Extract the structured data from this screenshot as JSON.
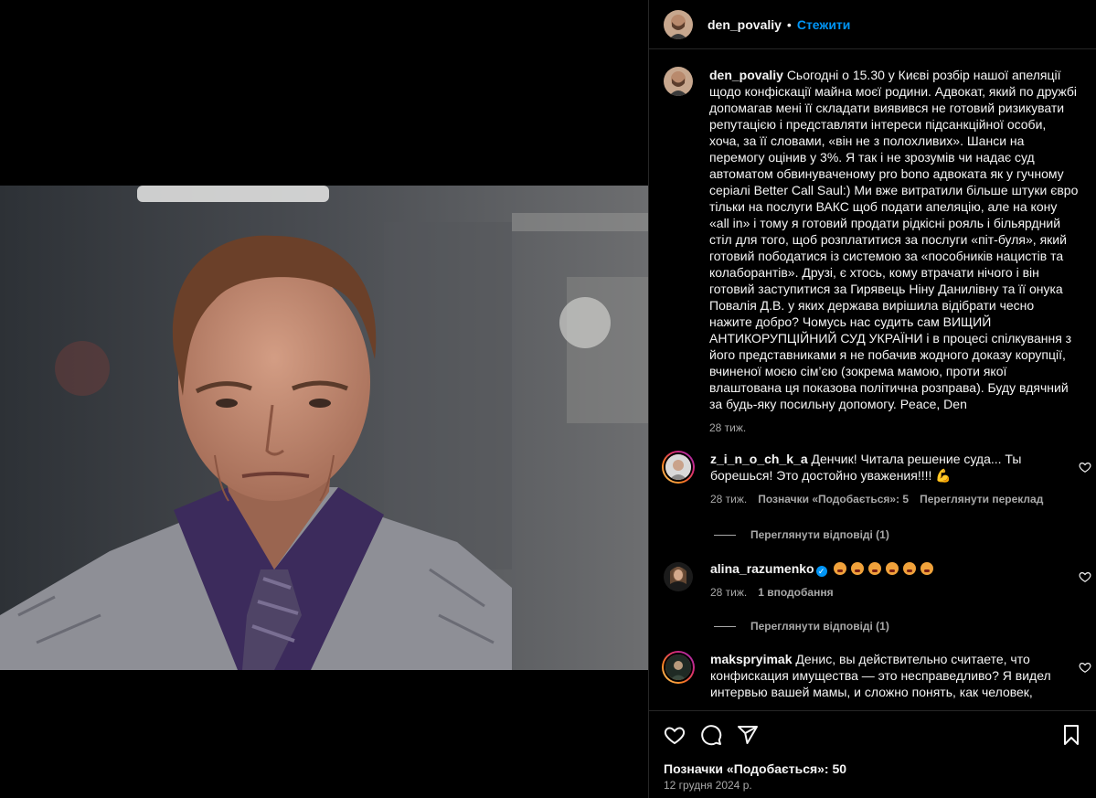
{
  "header": {
    "username": "den_povaliy",
    "separator": "•",
    "follow_label": "Стежити"
  },
  "caption": {
    "username": "den_povaliy",
    "text": "Сьогодні о 15.30 у Києві розбір нашої апеляції щодо конфіскації майна моєї родини. Адвокат, який по дружбі допомагав мені її складати виявився не готовий ризикувати репутацією і представляти інтереси підсанкційної особи, хоча, за її словами, «він не з полохливих». Шанси на перемогу оцінив у 3%. Я так і не зрозумів чи надає суд автоматом обвинуваченому pro bono адвоката як у гучному серіалі Better Call Saul:) Ми вже витратили більше штуки євро тільки на послуги ВАКС щоб подати апеляцію, але на кону «all in» і тому я готовий продати рідкісні рояль і більярдний стіл для того, щоб розплатитися за послуги «піт-буля», який готовий пободатися із системою за «пособників нацистів та колаборантів». Друзі, є хтось, кому втрачати нічого і він готовий заступитися за Гирявець Ніну Данилівну та її онука Повалія Д.В. у яких держава вирішила відібрати чесно нажите добро? Чомусь нас судить сам ВИЩИЙ АНТИКОРУПЦІЙНИЙ СУД УКРАЇНИ і в процесі спілкування з його представниками я не побачив жодного доказу корупції, вчиненої моєю сім’єю (зокрема мамою, проти якої влаштована ця показова політична розправа). Буду вдячний за будь-яку посильну допомогу. Peace, Den",
    "time": "28 тиж."
  },
  "comments": [
    {
      "username": "z_i_n_o_ch_k_a",
      "text": "Денчик! Читала решение суда... Ты борешься! Это достойно уважения!!!! 💪",
      "time": "28 тиж.",
      "likes": "Позначки «Подобається»: 5",
      "translate": "Переглянути переклад",
      "replies": "Переглянути відповіді (1)"
    },
    {
      "username": "alina_razumenko",
      "verified": true,
      "emoji_count": 6,
      "emoji_icon": "angry-face-emoji",
      "time": "28 тиж.",
      "likes": "1 вподобання",
      "replies": "Переглянути відповіді (1)"
    },
    {
      "username": "makspryimak",
      "text": "Денис, вы действительно считаете, что конфискация имущества — это несправедливо? Я видел интервью вашей мамы, и сложно понять, как человек,"
    }
  ],
  "footer": {
    "likes": "Позначки «Подобається»: 50",
    "date": "12 грудня 2024 р."
  },
  "colors": {
    "background": "#000000",
    "text": "#f5f5f5",
    "secondary": "#a8a8a8",
    "accent": "#0095f6",
    "divider": "#262626"
  },
  "icons": [
    "heart-icon",
    "comment-icon",
    "share-icon",
    "save-icon",
    "verified-icon"
  ]
}
